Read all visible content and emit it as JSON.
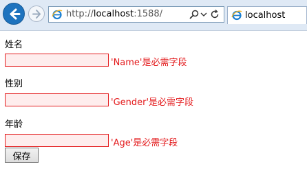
{
  "browser": {
    "url_prefix": "http://",
    "url_host": "localhost",
    "url_suffix": ":1588/",
    "tab_title": "localhost"
  },
  "form": {
    "fields": [
      {
        "label": "姓名",
        "value": "",
        "error": "'Name'是必需字段"
      },
      {
        "label": "性别",
        "value": "",
        "error": "'Gender'是必需字段"
      },
      {
        "label": "年龄",
        "value": "",
        "error": "'Age'是必需字段"
      }
    ],
    "save_label": "保存"
  },
  "colors": {
    "error": "#e3191b",
    "input_error_bg": "#feeded",
    "chrome_bg": "#dfe9f5",
    "back_button": "#1e73be"
  }
}
